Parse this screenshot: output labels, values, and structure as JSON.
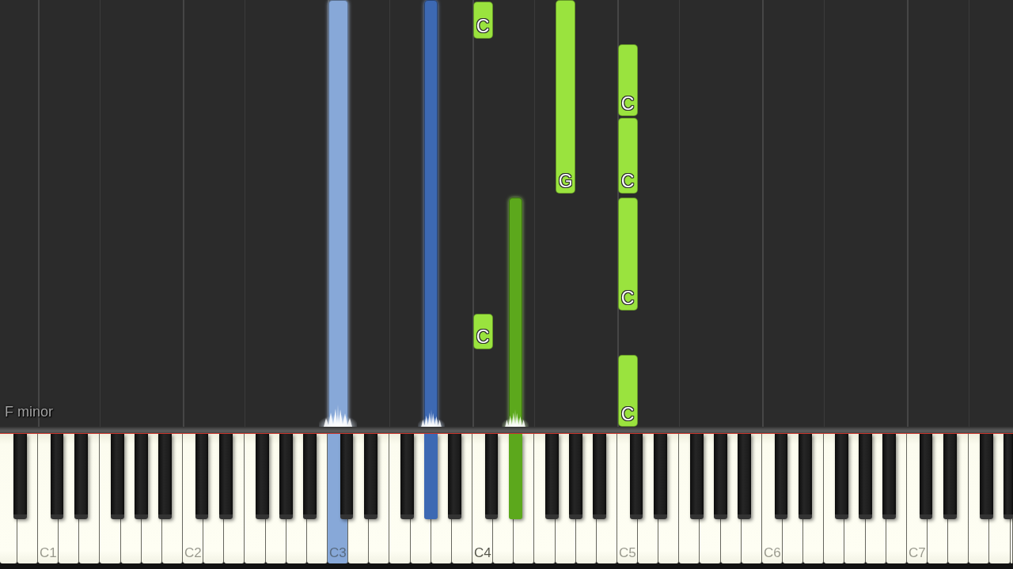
{
  "roll": {
    "notes": [
      {
        "color": "#87a8d8",
        "playing": true
      },
      {
        "color": "#3d69b3",
        "playing": true
      },
      {
        "label": "C",
        "color": "#9ae33e",
        "playing": false
      },
      {
        "label": "C",
        "color": "#9ae33e",
        "playing": false
      },
      {
        "color": "#5ca81c",
        "playing": true
      },
      {
        "label": "G",
        "color": "#9ae33e",
        "playing": false
      },
      {
        "label": "C",
        "color": "#9ae33e",
        "playing": false
      },
      {
        "label": "C",
        "color": "#9ae33e",
        "playing": false
      },
      {
        "label": "C",
        "color": "#9ae33e",
        "playing": false
      },
      {
        "label": "C",
        "color": "#9ae33e",
        "playing": false
      }
    ],
    "key_signature": "F minor"
  },
  "keyboard": {
    "octave_labels": [
      {
        "text": "C1",
        "emphasized": false
      },
      {
        "text": "C2",
        "emphasized": false
      },
      {
        "text": "C3",
        "emphasized": false
      },
      {
        "text": "C4",
        "emphasized": true
      },
      {
        "text": "C5",
        "emphasized": false
      },
      {
        "text": "C6",
        "emphasized": false
      },
      {
        "text": "C7",
        "emphasized": false
      }
    ]
  }
}
